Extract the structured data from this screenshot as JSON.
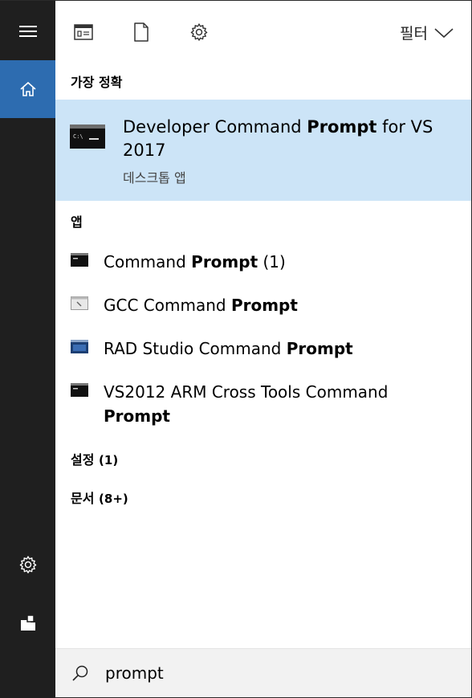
{
  "toolbar": {
    "icons": [
      "apps-doc-icon",
      "document-icon",
      "settings-gear-icon"
    ],
    "filter_label": "필터"
  },
  "rail": {
    "icons": [
      "hamburger-menu-icon",
      "home-icon",
      "settings-gear-icon",
      "user-account-icon"
    ]
  },
  "best_match": {
    "section_label": "가장 정확",
    "title_prefix": "Developer Command ",
    "title_bold": "Prompt",
    "title_suffix": " for VS 2017",
    "subtitle": "데스크톱 앱"
  },
  "apps": {
    "section_label": "앱",
    "items": [
      {
        "prefix": "Command ",
        "bold": "Prompt",
        "suffix": " (1)"
      },
      {
        "prefix": "GCC Command ",
        "bold": "Prompt",
        "suffix": ""
      },
      {
        "prefix": "RAD Studio Command ",
        "bold": "Prompt",
        "suffix": ""
      },
      {
        "prefix": "VS2012 ARM Cross Tools Command ",
        "bold": "Prompt",
        "suffix": ""
      }
    ]
  },
  "settings_section": {
    "label": "설정",
    "count": "(1)"
  },
  "documents_section": {
    "label": "문서",
    "count": "(8+)"
  },
  "search": {
    "value": "prompt"
  },
  "colors": {
    "rail_bg": "#1f1f1f",
    "rail_selected": "#2d6cb0",
    "best_match_bg": "#cce4f7",
    "search_bg": "#f2f2f2"
  }
}
